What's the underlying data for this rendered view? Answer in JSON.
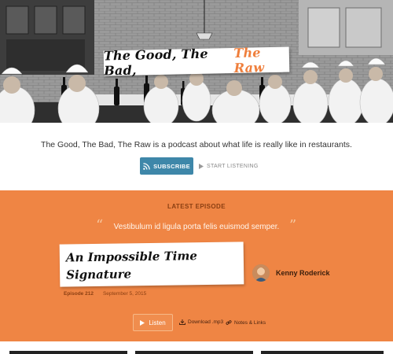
{
  "hero": {
    "title_main": "The Good, The Bad,",
    "title_accent": "The Raw"
  },
  "intro": {
    "tagline": "The Good, The Bad, The Raw is a podcast about what life is really like in restaurants.",
    "subscribe_label": "SUBSCRIBE",
    "start_listening_label": "START LISTENING"
  },
  "episode": {
    "section_label": "LATEST EPISODE",
    "quote": "Vestibulum id ligula porta felis euismod semper.",
    "title": "An Impossible Time Signature",
    "author": "Kenny Roderick",
    "number": "Episode 212",
    "date": "September 5, 2015",
    "listen_label": "Listen",
    "download_label": "Download .mp3",
    "notes_label": "Notes & Links"
  },
  "colors": {
    "accent_orange": "#ef8544",
    "title_accent": "#ef7e3b",
    "subscribe_blue": "#3e87a9"
  },
  "icons": {
    "subscribe": "rss-icon",
    "start_listening": "play-icon",
    "listen": "play-icon",
    "download": "download-icon",
    "notes": "link-icon"
  }
}
